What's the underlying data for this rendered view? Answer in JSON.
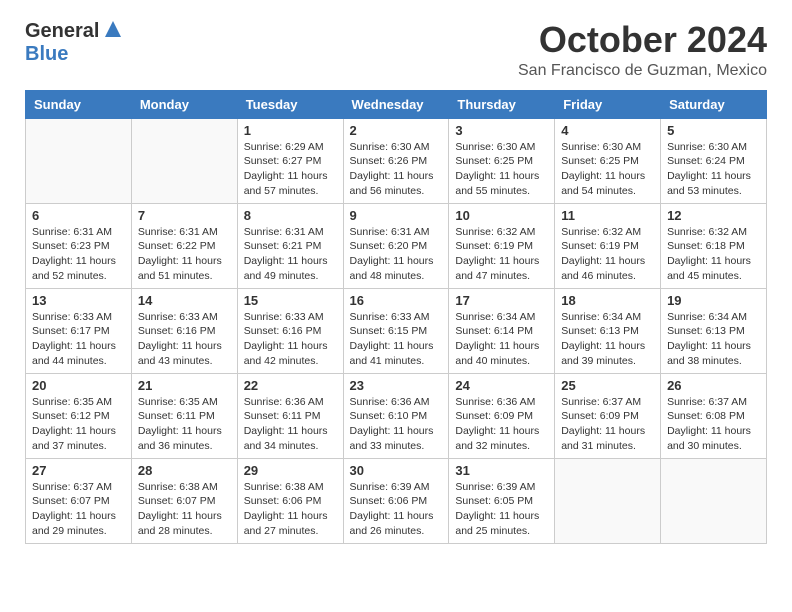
{
  "header": {
    "logo_general": "General",
    "logo_blue": "Blue",
    "month": "October 2024",
    "location": "San Francisco de Guzman, Mexico"
  },
  "calendar": {
    "days_of_week": [
      "Sunday",
      "Monday",
      "Tuesday",
      "Wednesday",
      "Thursday",
      "Friday",
      "Saturday"
    ],
    "weeks": [
      [
        {
          "day": "",
          "info": ""
        },
        {
          "day": "",
          "info": ""
        },
        {
          "day": "1",
          "info": "Sunrise: 6:29 AM\nSunset: 6:27 PM\nDaylight: 11 hours\nand 57 minutes."
        },
        {
          "day": "2",
          "info": "Sunrise: 6:30 AM\nSunset: 6:26 PM\nDaylight: 11 hours\nand 56 minutes."
        },
        {
          "day": "3",
          "info": "Sunrise: 6:30 AM\nSunset: 6:25 PM\nDaylight: 11 hours\nand 55 minutes."
        },
        {
          "day": "4",
          "info": "Sunrise: 6:30 AM\nSunset: 6:25 PM\nDaylight: 11 hours\nand 54 minutes."
        },
        {
          "day": "5",
          "info": "Sunrise: 6:30 AM\nSunset: 6:24 PM\nDaylight: 11 hours\nand 53 minutes."
        }
      ],
      [
        {
          "day": "6",
          "info": "Sunrise: 6:31 AM\nSunset: 6:23 PM\nDaylight: 11 hours\nand 52 minutes."
        },
        {
          "day": "7",
          "info": "Sunrise: 6:31 AM\nSunset: 6:22 PM\nDaylight: 11 hours\nand 51 minutes."
        },
        {
          "day": "8",
          "info": "Sunrise: 6:31 AM\nSunset: 6:21 PM\nDaylight: 11 hours\nand 49 minutes."
        },
        {
          "day": "9",
          "info": "Sunrise: 6:31 AM\nSunset: 6:20 PM\nDaylight: 11 hours\nand 48 minutes."
        },
        {
          "day": "10",
          "info": "Sunrise: 6:32 AM\nSunset: 6:19 PM\nDaylight: 11 hours\nand 47 minutes."
        },
        {
          "day": "11",
          "info": "Sunrise: 6:32 AM\nSunset: 6:19 PM\nDaylight: 11 hours\nand 46 minutes."
        },
        {
          "day": "12",
          "info": "Sunrise: 6:32 AM\nSunset: 6:18 PM\nDaylight: 11 hours\nand 45 minutes."
        }
      ],
      [
        {
          "day": "13",
          "info": "Sunrise: 6:33 AM\nSunset: 6:17 PM\nDaylight: 11 hours\nand 44 minutes."
        },
        {
          "day": "14",
          "info": "Sunrise: 6:33 AM\nSunset: 6:16 PM\nDaylight: 11 hours\nand 43 minutes."
        },
        {
          "day": "15",
          "info": "Sunrise: 6:33 AM\nSunset: 6:16 PM\nDaylight: 11 hours\nand 42 minutes."
        },
        {
          "day": "16",
          "info": "Sunrise: 6:33 AM\nSunset: 6:15 PM\nDaylight: 11 hours\nand 41 minutes."
        },
        {
          "day": "17",
          "info": "Sunrise: 6:34 AM\nSunset: 6:14 PM\nDaylight: 11 hours\nand 40 minutes."
        },
        {
          "day": "18",
          "info": "Sunrise: 6:34 AM\nSunset: 6:13 PM\nDaylight: 11 hours\nand 39 minutes."
        },
        {
          "day": "19",
          "info": "Sunrise: 6:34 AM\nSunset: 6:13 PM\nDaylight: 11 hours\nand 38 minutes."
        }
      ],
      [
        {
          "day": "20",
          "info": "Sunrise: 6:35 AM\nSunset: 6:12 PM\nDaylight: 11 hours\nand 37 minutes."
        },
        {
          "day": "21",
          "info": "Sunrise: 6:35 AM\nSunset: 6:11 PM\nDaylight: 11 hours\nand 36 minutes."
        },
        {
          "day": "22",
          "info": "Sunrise: 6:36 AM\nSunset: 6:11 PM\nDaylight: 11 hours\nand 34 minutes."
        },
        {
          "day": "23",
          "info": "Sunrise: 6:36 AM\nSunset: 6:10 PM\nDaylight: 11 hours\nand 33 minutes."
        },
        {
          "day": "24",
          "info": "Sunrise: 6:36 AM\nSunset: 6:09 PM\nDaylight: 11 hours\nand 32 minutes."
        },
        {
          "day": "25",
          "info": "Sunrise: 6:37 AM\nSunset: 6:09 PM\nDaylight: 11 hours\nand 31 minutes."
        },
        {
          "day": "26",
          "info": "Sunrise: 6:37 AM\nSunset: 6:08 PM\nDaylight: 11 hours\nand 30 minutes."
        }
      ],
      [
        {
          "day": "27",
          "info": "Sunrise: 6:37 AM\nSunset: 6:07 PM\nDaylight: 11 hours\nand 29 minutes."
        },
        {
          "day": "28",
          "info": "Sunrise: 6:38 AM\nSunset: 6:07 PM\nDaylight: 11 hours\nand 28 minutes."
        },
        {
          "day": "29",
          "info": "Sunrise: 6:38 AM\nSunset: 6:06 PM\nDaylight: 11 hours\nand 27 minutes."
        },
        {
          "day": "30",
          "info": "Sunrise: 6:39 AM\nSunset: 6:06 PM\nDaylight: 11 hours\nand 26 minutes."
        },
        {
          "day": "31",
          "info": "Sunrise: 6:39 AM\nSunset: 6:05 PM\nDaylight: 11 hours\nand 25 minutes."
        },
        {
          "day": "",
          "info": ""
        },
        {
          "day": "",
          "info": ""
        }
      ]
    ]
  }
}
